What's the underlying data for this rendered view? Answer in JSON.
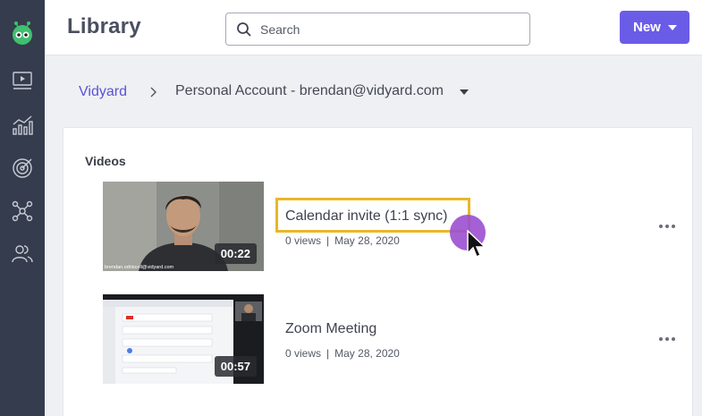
{
  "app": {
    "title": "Library"
  },
  "search": {
    "placeholder": "Search",
    "value": ""
  },
  "toolbar": {
    "new_label": "New"
  },
  "breadcrumb": {
    "root": "Vidyard",
    "account": "Personal Account - brendan@vidyard.com"
  },
  "section": {
    "label": "Videos"
  },
  "videos": [
    {
      "title": "Calendar invite (1:1 sync)",
      "views": "0 views",
      "separator": "|",
      "date": "May 28, 2020",
      "duration": "00:22",
      "thumb_caption": "brendan.odriscoll@vidyard.com"
    },
    {
      "title": "Zoom Meeting",
      "views": "0 views",
      "separator": "|",
      "date": "May 28, 2020",
      "duration": "00:57"
    }
  ],
  "colors": {
    "accent": "#6b5ce7",
    "sidebar": "#353c4d",
    "highlight": "#e9b728",
    "cursor_dot": "#9b4fd0"
  }
}
